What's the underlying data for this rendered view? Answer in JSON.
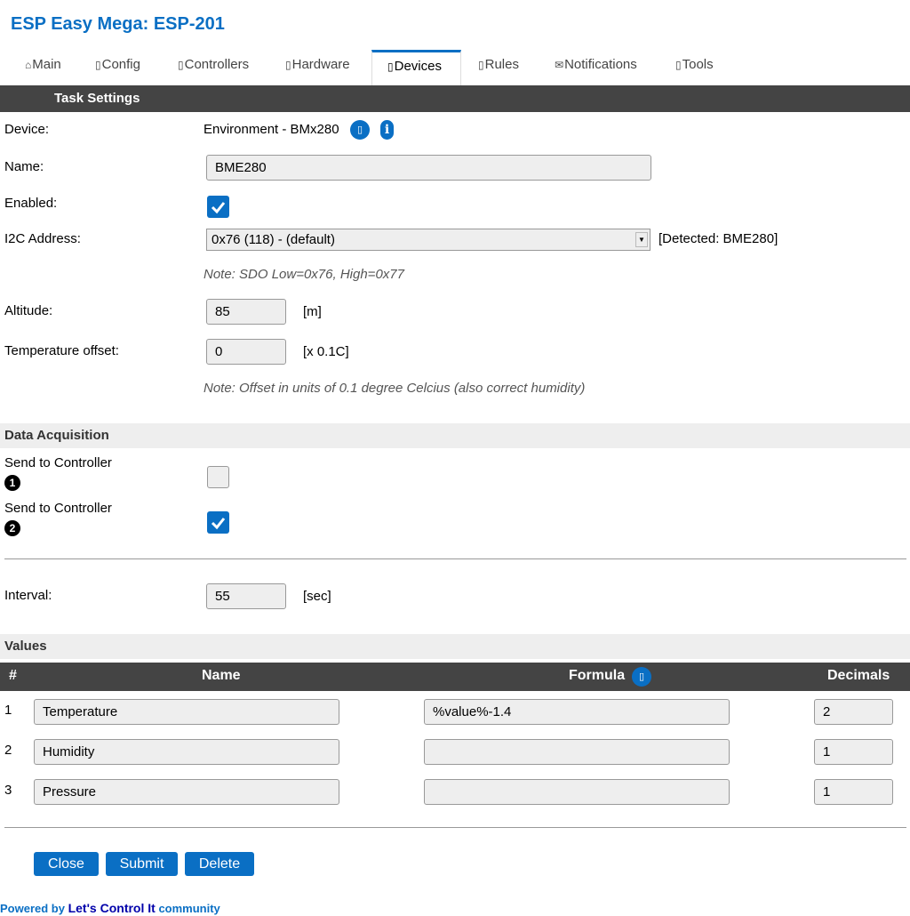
{
  "header": {
    "title": "ESP Easy Mega: ESP-201"
  },
  "tabs": [
    {
      "glyph": "⌂",
      "label": "Main"
    },
    {
      "glyph": "▯",
      "label": "Config"
    },
    {
      "glyph": "▯",
      "label": "Controllers"
    },
    {
      "glyph": "▯",
      "label": "Hardware"
    },
    {
      "glyph": "▯",
      "label": "Devices",
      "active": true
    },
    {
      "glyph": "▯",
      "label": "Rules"
    },
    {
      "glyph": "✉",
      "label": "Notifications"
    },
    {
      "glyph": "▯",
      "label": "Tools"
    }
  ],
  "task_settings": {
    "section_title": "Task Settings",
    "device_label": "Device:",
    "device_value": "Environment - BMx280",
    "name_label": "Name:",
    "name_value": "BME280",
    "enabled_label": "Enabled:",
    "enabled": true,
    "i2c_label": "I2C Address:",
    "i2c_value": "0x76 (118) - (default)",
    "i2c_detected": "[Detected: BME280]",
    "i2c_note": "Note: SDO Low=0x76, High=0x77",
    "altitude_label": "Altitude:",
    "altitude_value": "85",
    "altitude_unit": "[m]",
    "temp_offset_label": "Temperature offset:",
    "temp_offset_value": "0",
    "temp_offset_unit": "[x 0.1C]",
    "temp_offset_note": "Note: Offset in units of 0.1 degree Celcius (also correct humidity)"
  },
  "data_acquisition": {
    "section_title": "Data Acquisition",
    "controllers": [
      {
        "label": "Send to Controller",
        "badge": "1",
        "checked": false
      },
      {
        "label": "Send to Controller",
        "badge": "2",
        "checked": true
      }
    ],
    "interval_label": "Interval:",
    "interval_value": "55",
    "interval_unit": "[sec]"
  },
  "values": {
    "section_title": "Values",
    "headers": {
      "num": "#",
      "name": "Name",
      "formula": "Formula",
      "decimals": "Decimals"
    },
    "rows": [
      {
        "num": "1",
        "name": "Temperature",
        "formula": "%value%-1.4",
        "decimals": "2"
      },
      {
        "num": "2",
        "name": "Humidity",
        "formula": "",
        "decimals": "1"
      },
      {
        "num": "3",
        "name": "Pressure",
        "formula": "",
        "decimals": "1"
      }
    ]
  },
  "buttons": {
    "close": "Close",
    "submit": "Submit",
    "delete": "Delete"
  },
  "footer": {
    "prefix": "Powered by",
    "link": "Let's Control It",
    "suffix": "community"
  },
  "colors": {
    "accent": "#0a6fc4",
    "dark_bar": "#444444",
    "light_bar": "#eeeeee"
  }
}
